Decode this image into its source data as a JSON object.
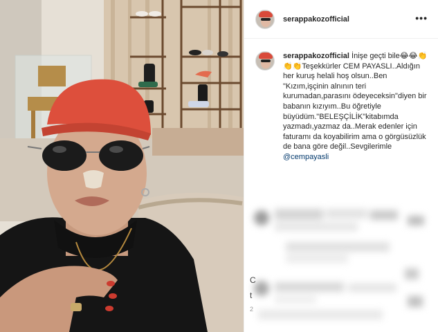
{
  "post": {
    "username": "serappakozofficial",
    "more_label": "•••"
  },
  "caption": {
    "username": "serappakozofficial",
    "body": " İnişe geçti bile😂😂👏👏👏Teşekkürler CEM PAYASLI..Aldığın her kuruş helali hoş olsun..Ben \"Kızım,işçinin alnının teri kurumadan,parasını ödeyeceksin\"diyen bir babanın kızıyım..Bu öğretiyle büyüdüm.\"BELEŞÇİLİK\"kitabımda yazmadı,yazmaz da..Merak edenler için faturamı da koyabilirim ama o görgüsüzlük de bana göre değil..Sevgilerimle",
    "mention": "@cempayasli"
  },
  "comments_section": {
    "side_letters": [
      "C",
      "t",
      "2"
    ]
  }
}
